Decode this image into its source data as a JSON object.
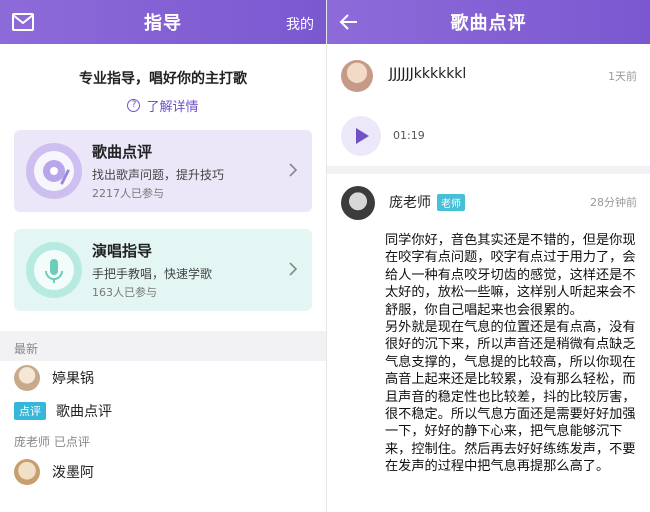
{
  "left": {
    "header": {
      "title": "指导",
      "right_link": "我的"
    },
    "intro": {
      "headline": "专业指导，唱好你的主打歌",
      "learn_more": "了解详情",
      "learn_icon": "?"
    },
    "cards": [
      {
        "title": "歌曲点评",
        "desc": "找出歌声问题，提升技巧",
        "count": "2217人已参与"
      },
      {
        "title": "演唱指导",
        "desc": "手把手教唱，快速学歌",
        "count": "163人已参与"
      }
    ],
    "section_label": "最新",
    "feed": {
      "user1": "婷果锅",
      "tag": "点评",
      "song": "歌曲点评",
      "meta": "庞老师 已点评",
      "user2": "泼墨阿"
    }
  },
  "right": {
    "header": {
      "title": "歌曲点评"
    },
    "message1": {
      "user": "JJJJJJkkkkkkl",
      "time": "1天前",
      "duration": "01:19"
    },
    "message2": {
      "user": "庞老师",
      "tag": "老师",
      "time": "28分钟前",
      "body": "同学你好，音色其实还是不错的，但是你现在咬字有点问题，咬字有点过于用力了，会给人一种有点咬牙切齿的感觉，这样还是不太好的，放松一些嘛，这样别人听起来会不舒服，你自己唱起来也会很累的。\n另外就是现在气息的位置还是有点高，没有很好的沉下来，所以声音还是稍微有点缺乏气息支撑的，气息提的比较高，所以你现在高音上起来还是比较累，没有那么轻松，而且声音的稳定性也比较差，抖的比较厉害，很不稳定。所以气息方面还是需要好好加强一下，好好的静下心来，把气息能够沉下来，控制住。然后再去好好练练发声，不要在发声的过程中把气息再提那么高了。"
    }
  },
  "colors": {
    "header": "#7a58d0",
    "accent": "#6f52c8",
    "tag": "#36b6d9"
  }
}
